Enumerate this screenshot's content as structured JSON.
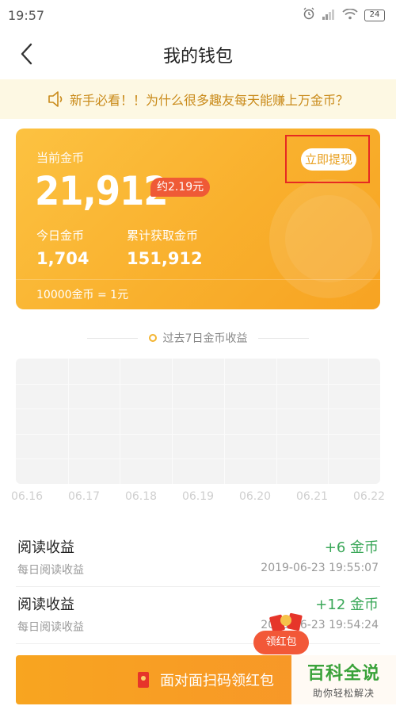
{
  "status": {
    "time": "19:57",
    "battery": "24"
  },
  "nav": {
    "title": "我的钱包"
  },
  "notice": {
    "text": "新手必看！！为什么很多趣友每天能赚上万金币？"
  },
  "wallet": {
    "current_label": "当前金币",
    "current_value": "21,912",
    "yuan": "约2.19元",
    "withdraw": "立即提现",
    "today_label": "今日金币",
    "today_value": "1,704",
    "total_label": "累计获取金币",
    "total_value": "151,912",
    "rate": "10000金币 = 1元"
  },
  "history": {
    "title": "过去7日金币收益",
    "dates": [
      "06.16",
      "06.17",
      "06.18",
      "06.19",
      "06.20",
      "06.21",
      "06.22"
    ]
  },
  "records": [
    {
      "title": "阅读收益",
      "sub": "每日阅读收益",
      "amount": "+6 金币",
      "time": "2019-06-23 19:55:07"
    },
    {
      "title": "阅读收益",
      "sub": "每日阅读收益",
      "amount": "+12 金币",
      "time": "2019-06-23 19:54:24"
    }
  ],
  "bottom": {
    "button": "面对面扫码领红包",
    "badge": "领红包"
  },
  "watermark": {
    "line1": "百科全说",
    "line2": "助你轻松解决"
  },
  "colors": {
    "card": "#f9b02d",
    "accent_red": "#ef5a36",
    "positive": "#3aa758",
    "highlight_frame": "#e62a22"
  }
}
